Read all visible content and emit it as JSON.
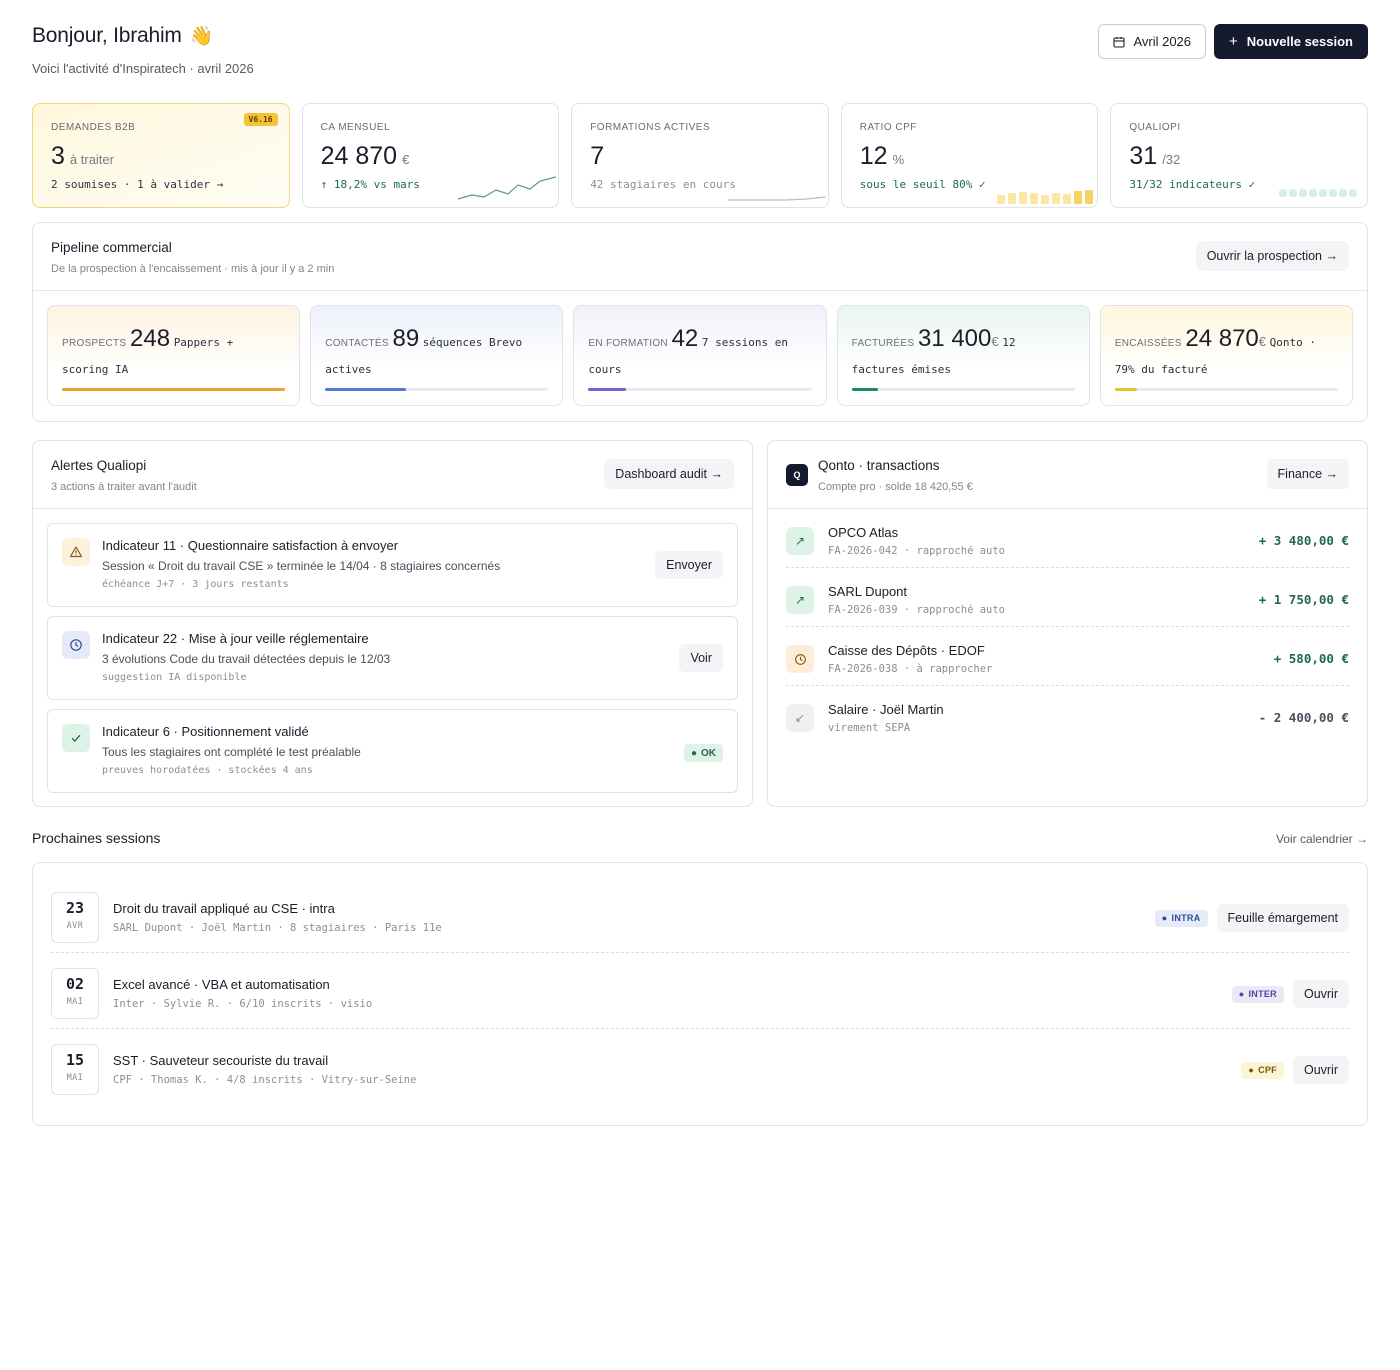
{
  "header": {
    "greeting": "Bonjour, Ibrahim",
    "wave": "👋",
    "subtitle": "Voici l'activité d'Inspiratech · avril 2026",
    "month_button": "Avril 2026",
    "new_session_button": "Nouvelle session"
  },
  "kpis": [
    {
      "label": "DEMANDES B2B",
      "value": "3",
      "unit": "à traiter",
      "foot": "2 soumises · 1 à valider →",
      "badge": "V6.16"
    },
    {
      "label": "CA MENSUEL",
      "value": "24 870",
      "unit": "€",
      "foot": "↑ 18,2% vs mars"
    },
    {
      "label": "FORMATIONS ACTIVES",
      "value": "7",
      "unit": "",
      "foot": "42 stagiaires en cours"
    },
    {
      "label": "RATIO CPF",
      "value": "12",
      "unit": "%",
      "foot": "sous le seuil 80% ✓"
    },
    {
      "label": "QUALIOPI",
      "value": "31",
      "unit": "/32",
      "foot": "31/32 indicateurs ✓"
    }
  ],
  "pipeline": {
    "title": "Pipeline commercial",
    "subtitle": "De la prospection à l'encaissement · mis à jour il y a 2 min",
    "button": "Ouvrir la prospection →",
    "stages": [
      {
        "label": "PROSPECTS",
        "value": "248",
        "unit": "",
        "desc": "Pappers + scoring IA",
        "progress": 1.0,
        "color": "#e8a12a"
      },
      {
        "label": "CONTACTÉS",
        "value": "89",
        "unit": "",
        "desc": "séquences Brevo actives",
        "progress": 0.36,
        "color": "#4f7bd6"
      },
      {
        "label": "EN FORMATION",
        "value": "42",
        "unit": "",
        "desc": "7 sessions en cours",
        "progress": 0.17,
        "color": "#7b5fcf"
      },
      {
        "label": "FACTURÉES",
        "value": "31 400",
        "unit": "€",
        "desc": "12 factures émises",
        "progress": 0.12,
        "color": "#1f8a5a"
      },
      {
        "label": "ENCAISSÉES",
        "value": "24 870",
        "unit": "€",
        "desc": "Qonto · 79% du facturé",
        "progress": 0.1,
        "color": "#e8c12a"
      }
    ]
  },
  "alerts": {
    "title": "Alertes Qualiopi",
    "subtitle": "3 actions à traiter avant l'audit",
    "button": "Dashboard audit →",
    "items": [
      {
        "title": "Indicateur 11 · Questionnaire satisfaction à envoyer",
        "desc": "Session « Droit du travail CSE » terminée le 14/04 · 8 stagiaires concernés",
        "meta": "échéance J+7 · 3 jours restants",
        "action": "Envoyer",
        "icon": "warning-icon"
      },
      {
        "title": "Indicateur 22 · Mise à jour veille réglementaire",
        "desc": "3 évolutions Code du travail détectées depuis le 12/03",
        "meta": "suggestion IA disponible",
        "action": "Voir",
        "icon": "clock-icon"
      },
      {
        "title": "Indicateur 6 · Positionnement validé",
        "desc": "Tous les stagiaires ont complété le test préalable",
        "meta": "preuves horodatées · stockées 4 ans",
        "status": "OK",
        "icon": "check-icon"
      }
    ]
  },
  "qonto": {
    "logo": "Q",
    "title": "Qonto · transactions",
    "subtitle": "Compte pro · solde 18 420,55 €",
    "button": "Finance →",
    "transactions": [
      {
        "name": "OPCO Atlas",
        "meta": "FA-2026-042 · rapproché auto",
        "amount": "+ 3 480,00 €",
        "type": "in"
      },
      {
        "name": "SARL Dupont",
        "meta": "FA-2026-039 · rapproché auto",
        "amount": "+ 1 750,00 €",
        "type": "in"
      },
      {
        "name": "Caisse des Dépôts · EDOF",
        "meta": "FA-2026-038 · à rapprocher",
        "amount": "+ 580,00 €",
        "type": "pending"
      },
      {
        "name": "Salaire · Joël Martin",
        "meta": "virement SEPA",
        "amount": "- 2 400,00 €",
        "type": "out"
      }
    ]
  },
  "sessions": {
    "title": "Prochaines sessions",
    "link": "Voir calendrier →",
    "items": [
      {
        "day": "23",
        "month": "AVR",
        "name": "Droit du travail appliqué au CSE · intra",
        "meta": "SARL Dupont · Joël Martin · 8 stagiaires · Paris 11e",
        "tag": "INTRA",
        "action": "Feuille émargement"
      },
      {
        "day": "02",
        "month": "MAI",
        "name": "Excel avancé · VBA et automatisation",
        "meta": "Inter · Sylvie R. · 6/10 inscrits · visio",
        "tag": "INTER",
        "action": "Ouvrir"
      },
      {
        "day": "15",
        "month": "MAI",
        "name": "SST · Sauveteur secouriste du travail",
        "meta": "CPF · Thomas K. · 4/8 inscrits · Vitry-sur-Seine",
        "tag": "CPF",
        "action": "Ouvrir"
      }
    ]
  }
}
